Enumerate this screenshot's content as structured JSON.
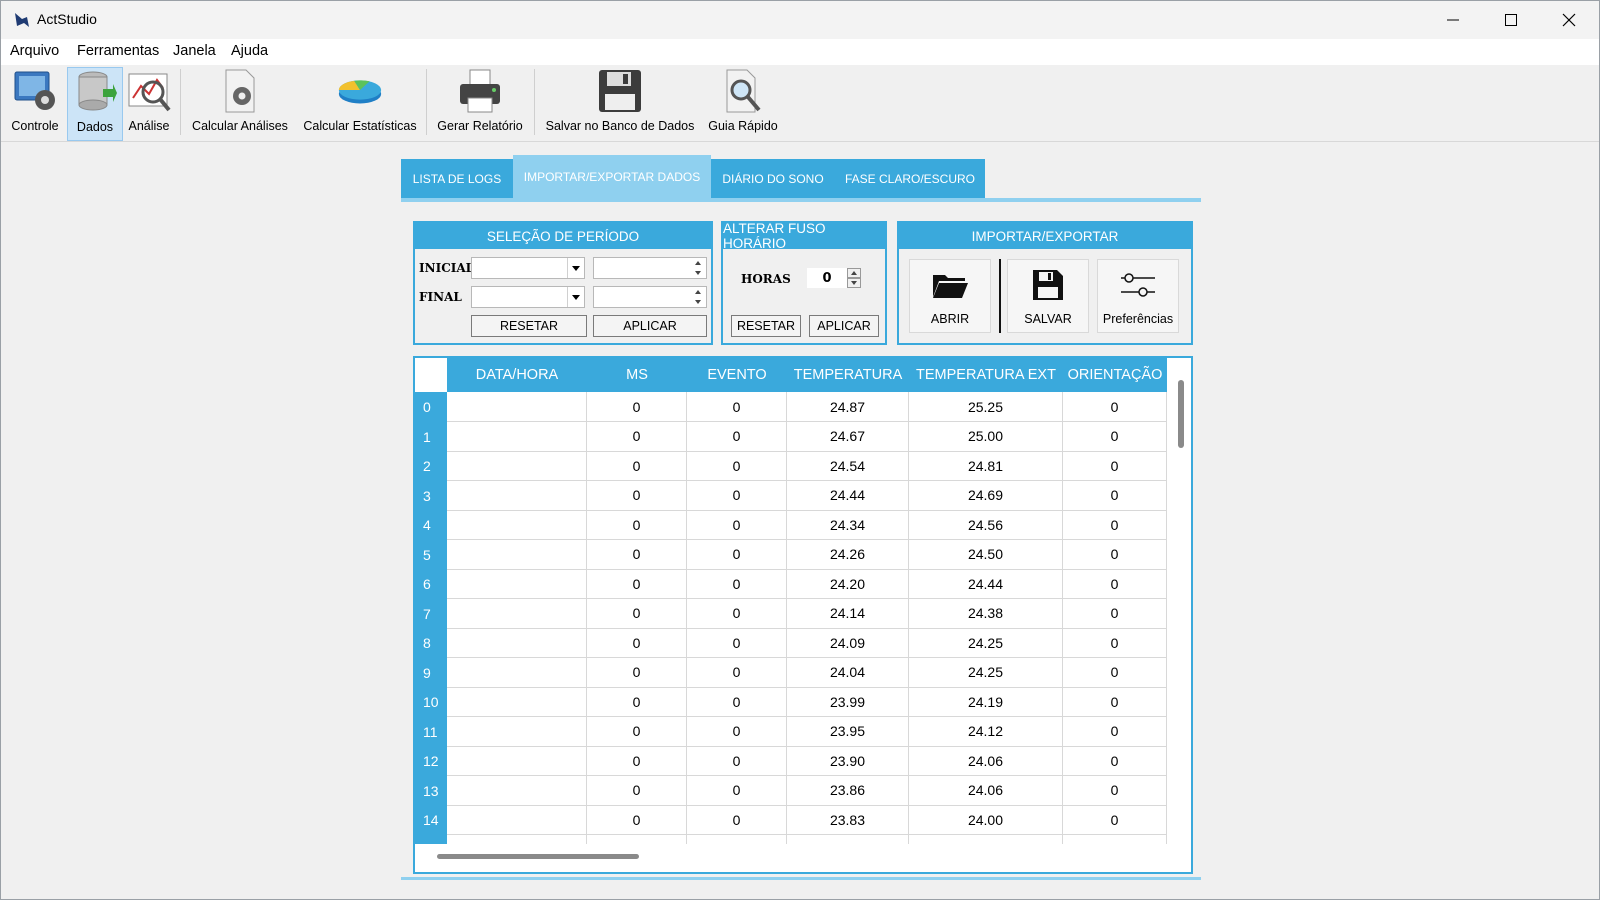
{
  "window": {
    "title": "ActStudio"
  },
  "menu": [
    "Arquivo",
    "Ferramentas",
    "Janela",
    "Ajuda"
  ],
  "toolbar": {
    "items": [
      {
        "label": "Controle",
        "icon": "monitor-gear-icon"
      },
      {
        "label": "Dados",
        "icon": "database-icon",
        "active": true
      },
      {
        "label": "Análise",
        "icon": "chart-magnifier-icon"
      },
      {
        "label": "Calcular Análises",
        "icon": "document-gear-icon"
      },
      {
        "label": "Calcular Estatísticas",
        "icon": "pie-chart-icon"
      },
      {
        "label": "Gerar Relatório",
        "icon": "printer-icon"
      },
      {
        "label": "Salvar no Banco de Dados",
        "icon": "floppy-disk-icon"
      },
      {
        "label": "Guia Rápido",
        "icon": "document-magnifier-icon"
      }
    ]
  },
  "tabs": [
    "LISTA DE LOGS",
    "IMPORTAR/EXPORTAR DADOS",
    "DIÁRIO DO SONO",
    "FASE CLARO/ESCURO"
  ],
  "selected_tab": "IMPORTAR/EXPORTAR DADOS",
  "periodo": {
    "title": "SELEÇÃO DE PERÍODO",
    "inicial_label": "INICIAL",
    "final_label": "FINAL",
    "inicial_date": "",
    "inicial_time": "",
    "final_date": "",
    "final_time": "",
    "reset": "RESETAR",
    "apply": "APLICAR"
  },
  "fuso": {
    "title": "ALTERAR FUSO HORÁRIO",
    "horas_label": "HORAS",
    "horas_value": "0",
    "reset": "RESETAR",
    "apply": "APLICAR"
  },
  "impexp": {
    "title": "IMPORTAR/EXPORTAR",
    "abrir": "ABRIR",
    "salvar": "SALVAR",
    "prefs": "Preferências"
  },
  "table": {
    "columns": [
      "DATA/HORA",
      "MS",
      "EVENTO",
      "TEMPERATURA",
      "TEMPERATURA EXT",
      "ORIENTAÇÃO"
    ],
    "rows": [
      {
        "id": "0",
        "data": "",
        "ms": "0",
        "evento": "0",
        "temp": "24.87",
        "temp_ext": "25.25",
        "orient": "0"
      },
      {
        "id": "1",
        "data": "",
        "ms": "0",
        "evento": "0",
        "temp": "24.67",
        "temp_ext": "25.00",
        "orient": "0"
      },
      {
        "id": "2",
        "data": "",
        "ms": "0",
        "evento": "0",
        "temp": "24.54",
        "temp_ext": "24.81",
        "orient": "0"
      },
      {
        "id": "3",
        "data": "",
        "ms": "0",
        "evento": "0",
        "temp": "24.44",
        "temp_ext": "24.69",
        "orient": "0"
      },
      {
        "id": "4",
        "data": "",
        "ms": "0",
        "evento": "0",
        "temp": "24.34",
        "temp_ext": "24.56",
        "orient": "0"
      },
      {
        "id": "5",
        "data": "",
        "ms": "0",
        "evento": "0",
        "temp": "24.26",
        "temp_ext": "24.50",
        "orient": "0"
      },
      {
        "id": "6",
        "data": "",
        "ms": "0",
        "evento": "0",
        "temp": "24.20",
        "temp_ext": "24.44",
        "orient": "0"
      },
      {
        "id": "7",
        "data": "",
        "ms": "0",
        "evento": "0",
        "temp": "24.14",
        "temp_ext": "24.38",
        "orient": "0"
      },
      {
        "id": "8",
        "data": "",
        "ms": "0",
        "evento": "0",
        "temp": "24.09",
        "temp_ext": "24.25",
        "orient": "0"
      },
      {
        "id": "9",
        "data": "",
        "ms": "0",
        "evento": "0",
        "temp": "24.04",
        "temp_ext": "24.25",
        "orient": "0"
      },
      {
        "id": "10",
        "data": "",
        "ms": "0",
        "evento": "0",
        "temp": "23.99",
        "temp_ext": "24.19",
        "orient": "0"
      },
      {
        "id": "11",
        "data": "",
        "ms": "0",
        "evento": "0",
        "temp": "23.95",
        "temp_ext": "24.12",
        "orient": "0"
      },
      {
        "id": "12",
        "data": "",
        "ms": "0",
        "evento": "0",
        "temp": "23.90",
        "temp_ext": "24.06",
        "orient": "0"
      },
      {
        "id": "13",
        "data": "",
        "ms": "0",
        "evento": "0",
        "temp": "23.86",
        "temp_ext": "24.06",
        "orient": "0"
      },
      {
        "id": "14",
        "data": "",
        "ms": "0",
        "evento": "0",
        "temp": "23.83",
        "temp_ext": "24.00",
        "orient": "0"
      },
      {
        "id": "",
        "data": "",
        "ms": "",
        "evento": "",
        "temp": "",
        "temp_ext": "",
        "orient": ""
      }
    ]
  },
  "colors": {
    "accent": "#3aa9dc",
    "accent_light": "#8fd0ef",
    "toolbar_active": "#cce4f7"
  }
}
